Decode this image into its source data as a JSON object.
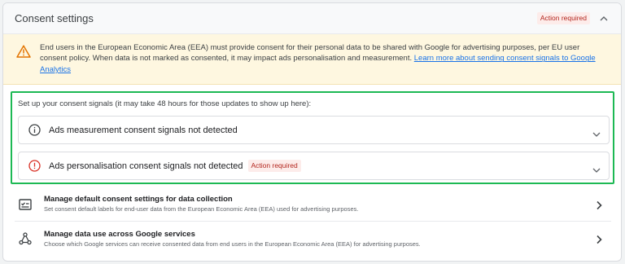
{
  "header": {
    "title": "Consent settings",
    "badge": "Action required",
    "collapse_icon": "chevron-up-icon"
  },
  "warning": {
    "icon": "warning-triangle-icon",
    "text": "End users in the European Economic Area (EEA) must provide consent for their personal data to be shared with Google for advertising purposes, per EU user consent policy. When data is not marked as consented, it may impact ads personalisation and measurement.",
    "link": "Learn more about sending consent signals to Google Analytics"
  },
  "consent_signals": {
    "intro": "Set up your consent signals (it may take 48 hours for those updates to show up here):",
    "items": [
      {
        "icon": "info-icon",
        "label": "Ads measurement consent signals not detected",
        "badge": ""
      },
      {
        "icon": "error-icon",
        "label": "Ads personalisation consent signals not detected",
        "badge": "Action required"
      }
    ]
  },
  "management": [
    {
      "icon": "checklist-icon",
      "title": "Manage default consent settings for data collection",
      "description": "Set consent default labels for end-user data from the European Economic Area (EEA) used for advertising purposes."
    },
    {
      "icon": "share-nodes-icon",
      "title": "Manage data use across Google services",
      "description": "Choose which Google services can receive consented data from end users in the European Economic Area (EEA) for advertising purposes."
    }
  ],
  "colors": {
    "highlight_border": "#1db954",
    "warning_bg": "#fef7e0",
    "badge_text": "#b3261e",
    "badge_bg": "#fdecea",
    "link": "#1a73e8"
  }
}
